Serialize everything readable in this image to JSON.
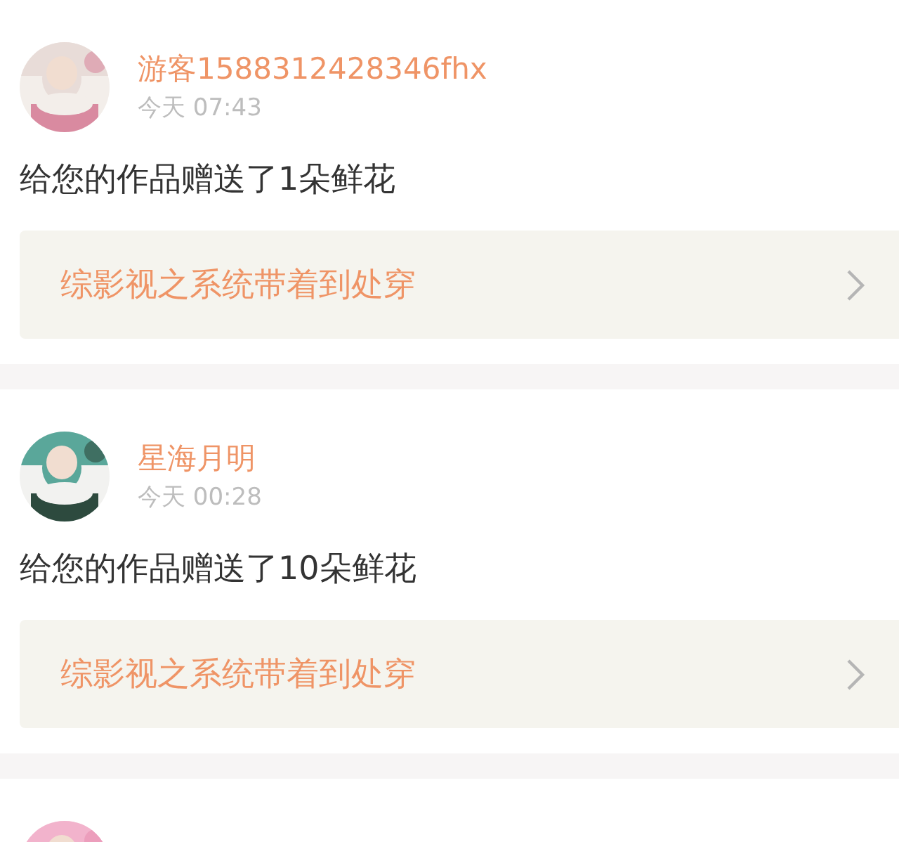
{
  "notifications": [
    {
      "avatar": {
        "kind": "picture"
      },
      "username": "游客1588312428346fhx",
      "time": "今天 07:43",
      "message": "给您的作品赠送了1朵鲜花",
      "work_link": "综影视之系统带着到处穿"
    },
    {
      "avatar": {
        "kind": "picture"
      },
      "username": "星海月明",
      "time": "今天 00:28",
      "message": "给您的作品赠送了10朵鲜花",
      "work_link": "综影视之系统带着到处穿"
    },
    {
      "avatar": {
        "kind": "picture"
      }
    }
  ]
}
